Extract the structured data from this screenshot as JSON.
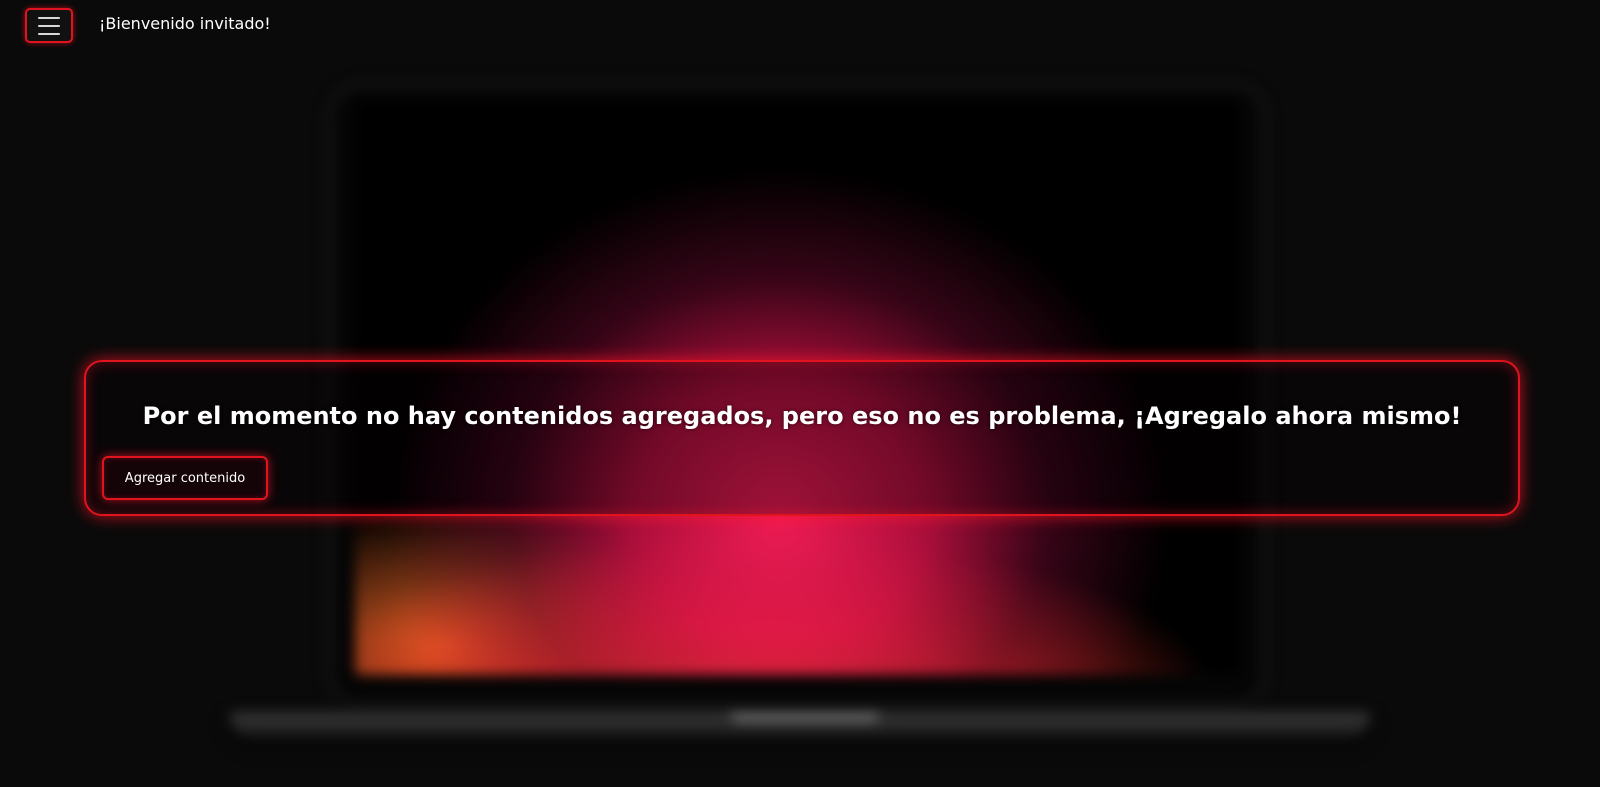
{
  "header": {
    "menu_icon": "hamburger-menu-icon",
    "welcome_text": "¡Bienvenido invitado!"
  },
  "main": {
    "message": "Por el momento no hay contenidos agregados, pero eso no es problema, ¡Agregalo ahora mismo!",
    "add_button_label": "Agregar contenido"
  },
  "theme": {
    "accent": "#e0141e",
    "background": "#0a0a0a"
  }
}
